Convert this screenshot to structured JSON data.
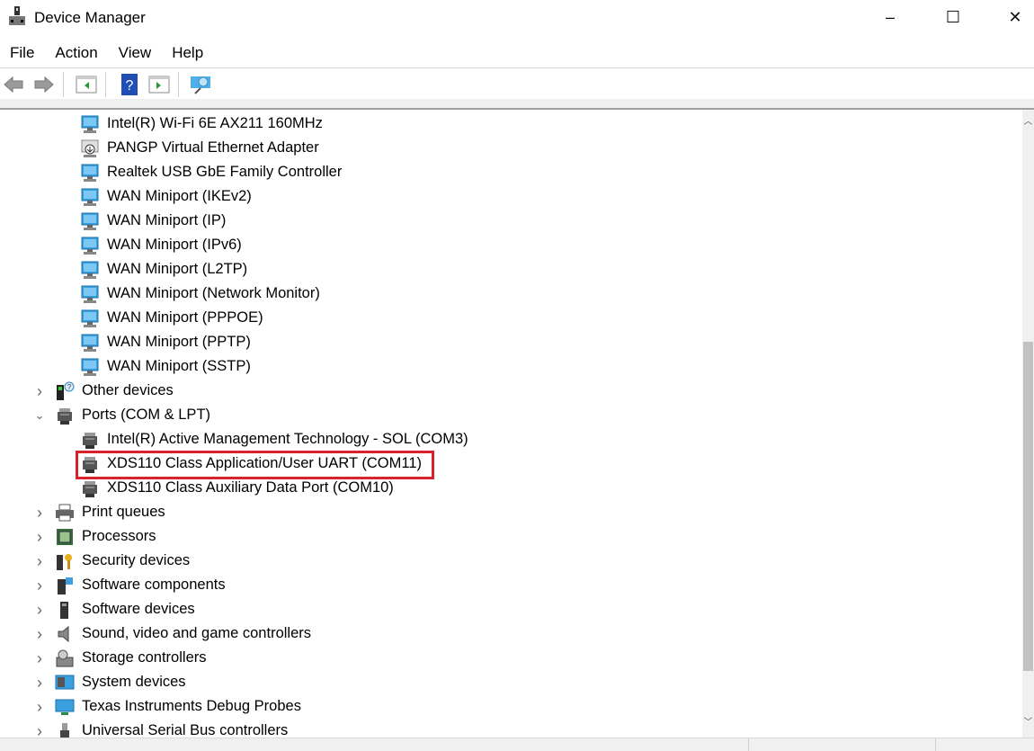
{
  "window": {
    "title": "Device Manager",
    "minimize": "–",
    "maximize": "☐",
    "close": "✕"
  },
  "menu": [
    "File",
    "Action",
    "View",
    "Help"
  ],
  "toolbar": [
    "back",
    "forward",
    "show-hide-console-tree",
    "help",
    "show-action-pane",
    "scan-hardware-changes"
  ],
  "colors": {
    "highlight": "#d8232a",
    "network": "#3aa0e0",
    "scroll_thumb": "#c2c2c2"
  },
  "tree": [
    {
      "label": "Intel(R) Wi-Fi 6E AX211 160MHz",
      "level": 2,
      "icon": "network-adapter"
    },
    {
      "label": "PANGP Virtual Ethernet Adapter",
      "level": 2,
      "icon": "network-adapter-disabled"
    },
    {
      "label": "Realtek USB GbE Family Controller",
      "level": 2,
      "icon": "network-adapter"
    },
    {
      "label": "WAN Miniport (IKEv2)",
      "level": 2,
      "icon": "network-adapter"
    },
    {
      "label": "WAN Miniport (IP)",
      "level": 2,
      "icon": "network-adapter"
    },
    {
      "label": "WAN Miniport (IPv6)",
      "level": 2,
      "icon": "network-adapter"
    },
    {
      "label": "WAN Miniport (L2TP)",
      "level": 2,
      "icon": "network-adapter"
    },
    {
      "label": "WAN Miniport (Network Monitor)",
      "level": 2,
      "icon": "network-adapter"
    },
    {
      "label": "WAN Miniport (PPPOE)",
      "level": 2,
      "icon": "network-adapter"
    },
    {
      "label": "WAN Miniport (PPTP)",
      "level": 2,
      "icon": "network-adapter"
    },
    {
      "label": "WAN Miniport (SSTP)",
      "level": 2,
      "icon": "network-adapter"
    },
    {
      "label": "Other devices",
      "level": 1,
      "expanded": false,
      "icon": "unknown-device"
    },
    {
      "label": "Ports (COM & LPT)",
      "level": 1,
      "expanded": true,
      "icon": "port"
    },
    {
      "label": "Intel(R) Active Management Technology - SOL (COM3)",
      "level": 2,
      "icon": "port"
    },
    {
      "label": "XDS110 Class Application/User UART (COM11)",
      "level": 2,
      "icon": "port",
      "highlighted": true
    },
    {
      "label": "XDS110 Class Auxiliary Data Port (COM10)",
      "level": 2,
      "icon": "port"
    },
    {
      "label": "Print queues",
      "level": 1,
      "expanded": false,
      "icon": "printer"
    },
    {
      "label": "Processors",
      "level": 1,
      "expanded": false,
      "icon": "processor"
    },
    {
      "label": "Security devices",
      "level": 1,
      "expanded": false,
      "icon": "security-key"
    },
    {
      "label": "Software components",
      "level": 1,
      "expanded": false,
      "icon": "software-component"
    },
    {
      "label": "Software devices",
      "level": 1,
      "expanded": false,
      "icon": "software-device"
    },
    {
      "label": "Sound, video and game controllers",
      "level": 1,
      "expanded": false,
      "icon": "speaker"
    },
    {
      "label": "Storage controllers",
      "level": 1,
      "expanded": false,
      "icon": "storage"
    },
    {
      "label": "System devices",
      "level": 1,
      "expanded": false,
      "icon": "system"
    },
    {
      "label": "Texas Instruments Debug Probes",
      "level": 1,
      "expanded": false,
      "icon": "monitor"
    },
    {
      "label": "Universal Serial Bus controllers",
      "level": 1,
      "expanded": false,
      "icon": "usb"
    }
  ]
}
